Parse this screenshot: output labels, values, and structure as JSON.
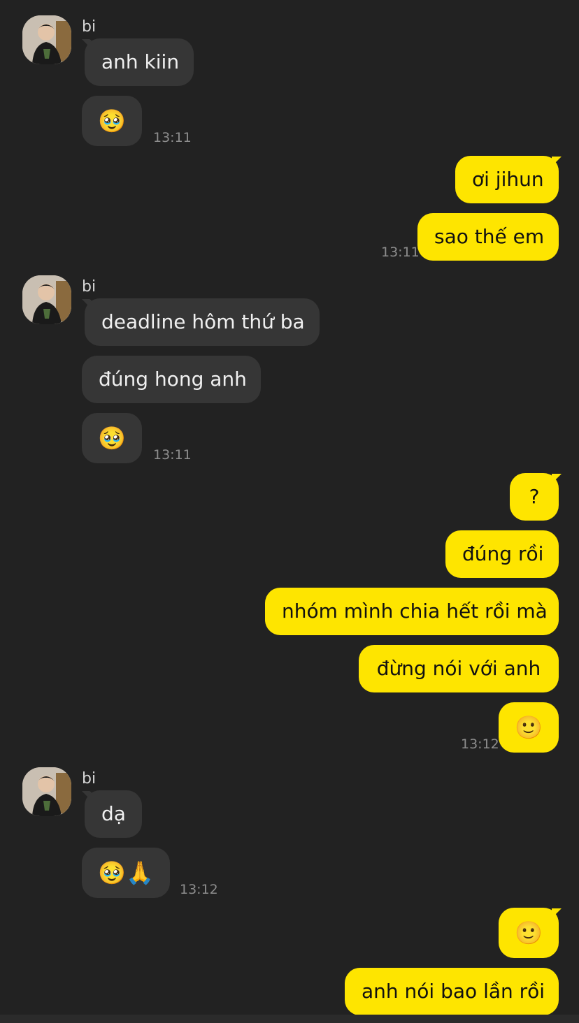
{
  "chat": {
    "sender_name": "bi",
    "groups": [
      {
        "messages": [
          "anh kiin",
          "🥹"
        ],
        "time": "13:11"
      },
      {
        "messages": [
          "ơi jihun",
          "sao thế em"
        ],
        "time": "13:11"
      },
      {
        "messages": [
          "deadline hôm thứ ba",
          "đúng hong anh",
          "🥹"
        ],
        "time": "13:11"
      },
      {
        "messages": [
          "?",
          "đúng rồi",
          "nhóm mình chia hết rồi mà",
          "đừng nói với anh",
          "🙂"
        ],
        "time": "13:12"
      },
      {
        "messages": [
          "dạ",
          "🥹🙏"
        ],
        "time": "13:12"
      },
      {
        "messages": [
          "🙂",
          "anh nói bao lần rồi"
        ]
      }
    ]
  },
  "colors": {
    "background": "#222222",
    "incoming_bubble": "#363636",
    "outgoing_bubble": "#fee500",
    "timestamp": "#8d8d8d"
  },
  "icons": {
    "avatar": "profile-photo"
  }
}
